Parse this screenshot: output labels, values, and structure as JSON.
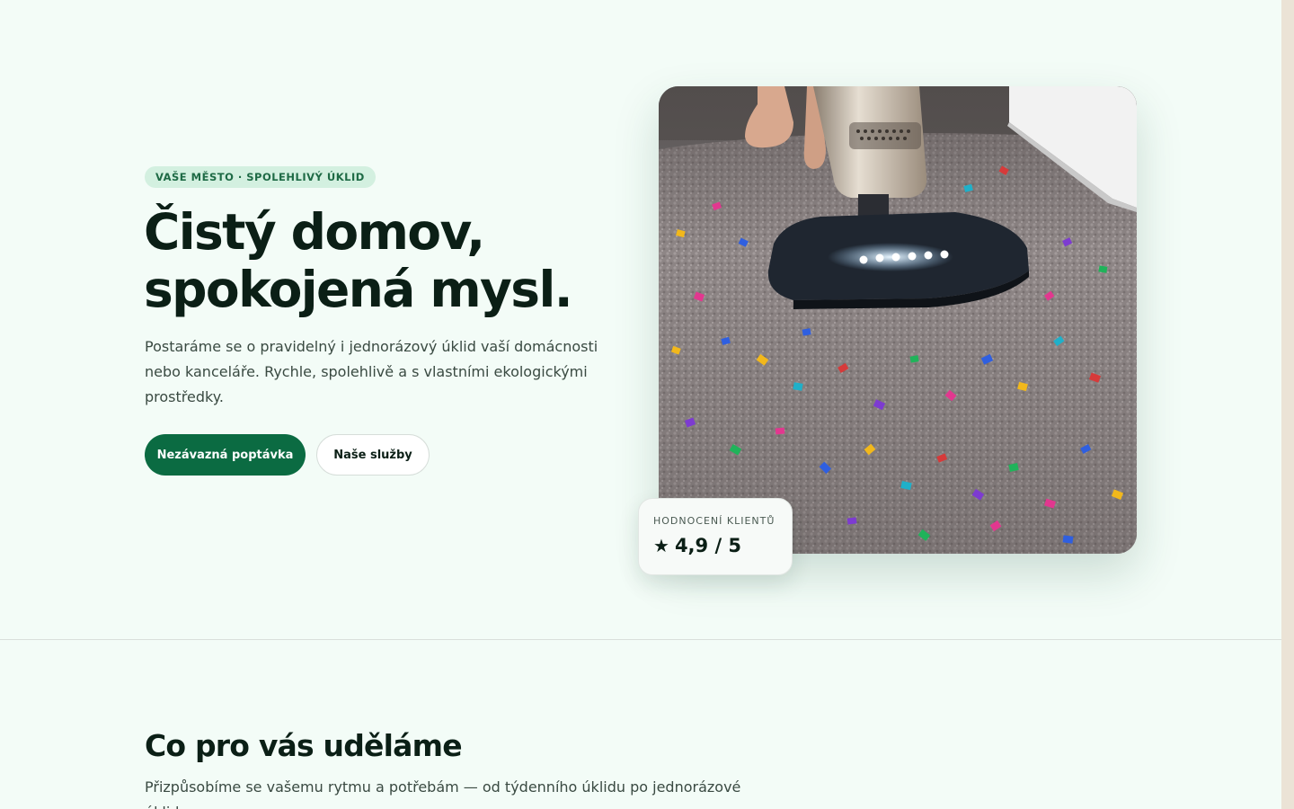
{
  "hero": {
    "badge": "VAŠE MĚSTO · SPOLEHLIVÝ ÚKLID",
    "title_line1": "Čistý domov,",
    "title_line2": "spokojená mysl.",
    "description": "Postaráme se o pravidelný i jednorázový úklid vaší domácnosti nebo kanceláře. Rychle, spolehlivě a s vlastními ekologickými prostředky.",
    "primary_button": "Nezávazná poptávka",
    "secondary_button": "Naše služby",
    "image_icon": "vacuum-cleaner-photo"
  },
  "rating": {
    "label": "HODNOCENÍ KLIENTŮ",
    "star_icon": "★",
    "value": "4,9 / 5"
  },
  "services": {
    "title": "Co pro vás uděláme",
    "description": "Přizpůsobíme se vašemu rytmu a potřebám — od týdenního úklidu po jednorázové úklidy"
  },
  "colors": {
    "background": "#f3fcf7",
    "accent": "#0b6b42",
    "badge_bg": "#d3f0e0",
    "badge_text": "#1e6a45",
    "heading": "#0b1f16"
  }
}
